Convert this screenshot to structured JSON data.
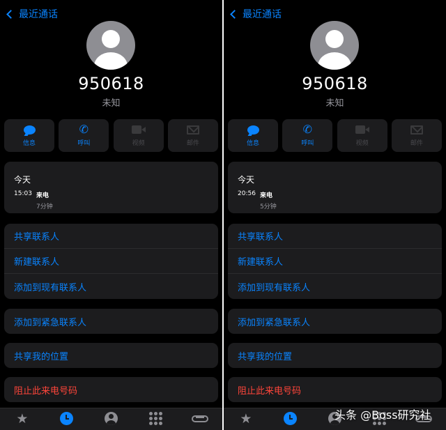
{
  "screens": [
    {
      "back_label": "最近通话",
      "number": "950618",
      "subtitle": "未知",
      "actions": [
        {
          "label": "信息",
          "icon": "message-icon",
          "enabled": true
        },
        {
          "label": "呼叫",
          "icon": "phone-icon",
          "enabled": true
        },
        {
          "label": "视频",
          "icon": "video-icon",
          "enabled": false
        },
        {
          "label": "邮件",
          "icon": "mail-icon",
          "enabled": false
        }
      ],
      "log": {
        "day": "今天",
        "time": "15:03",
        "type": "来电",
        "duration": "7分钟"
      },
      "menu": {
        "share_contact": "共享联系人",
        "new_contact": "新建联系人",
        "add_existing": "添加到现有联系人",
        "add_emergency": "添加到紧急联系人",
        "share_location": "共享我的位置",
        "block": "阻止此来电号码"
      }
    },
    {
      "back_label": "最近通话",
      "number": "950618",
      "subtitle": "未知",
      "actions": [
        {
          "label": "信息",
          "icon": "message-icon",
          "enabled": true
        },
        {
          "label": "呼叫",
          "icon": "phone-icon",
          "enabled": true
        },
        {
          "label": "视频",
          "icon": "video-icon",
          "enabled": false
        },
        {
          "label": "邮件",
          "icon": "mail-icon",
          "enabled": false
        }
      ],
      "log": {
        "day": "今天",
        "time": "20:56",
        "type": "来电",
        "duration": "5分钟"
      },
      "menu": {
        "share_contact": "共享联系人",
        "new_contact": "新建联系人",
        "add_existing": "添加到现有联系人",
        "add_emergency": "添加到紧急联系人",
        "share_location": "共享我的位置",
        "block": "阻止此来电号码"
      }
    }
  ],
  "tabbar_icons": [
    "star-icon",
    "clock-icon",
    "person-icon",
    "keypad-icon",
    "voicemail-icon"
  ],
  "watermark": "头条 @Boss研究社",
  "colors": {
    "accent": "#0a84ff",
    "danger": "#ff453a",
    "background": "#000000",
    "card": "#1c1c1e"
  }
}
